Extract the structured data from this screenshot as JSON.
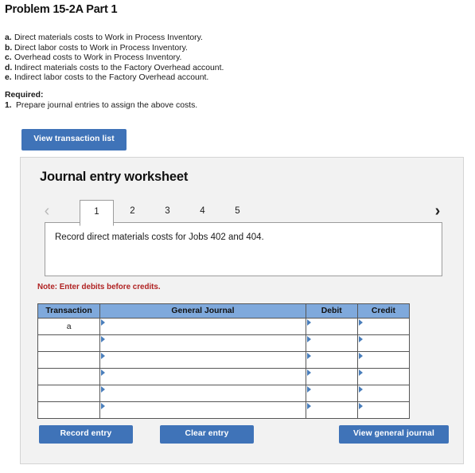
{
  "problem": {
    "title": "Problem 15-2A Part 1",
    "items": [
      {
        "letter": "a.",
        "text": "Direct materials costs to Work in Process Inventory."
      },
      {
        "letter": "b.",
        "text": "Direct labor costs to Work in Process Inventory."
      },
      {
        "letter": "c.",
        "text": "Overhead costs to Work in Process Inventory."
      },
      {
        "letter": "d.",
        "text": "Indirect materials costs to the Factory Overhead account."
      },
      {
        "letter": "e.",
        "text": "Indirect labor costs to the Factory Overhead account."
      }
    ],
    "required_label": "Required:",
    "required_items": [
      {
        "num": "1.",
        "text": "Prepare journal entries to assign the above costs."
      }
    ]
  },
  "toolbar": {
    "view_transaction_list_label": "View transaction list"
  },
  "worksheet": {
    "title": "Journal entry worksheet",
    "prev_arrow_icon": "chevron-left-icon",
    "next_arrow_icon": "chevron-right-icon",
    "tabs": [
      {
        "label": "1",
        "active": true
      },
      {
        "label": "2",
        "active": false
      },
      {
        "label": "3",
        "active": false
      },
      {
        "label": "4",
        "active": false
      },
      {
        "label": "5",
        "active": false
      }
    ],
    "instruction": "Record direct materials costs for Jobs 402 and 404.",
    "note": "Note: Enter debits before credits.",
    "note_color": "#b02222",
    "table": {
      "headers": [
        "Transaction",
        "General Journal",
        "Debit",
        "Credit"
      ],
      "header_bg": "#7fa9dc",
      "rows": [
        {
          "transaction": "a",
          "general_journal": "",
          "debit": "",
          "credit": ""
        },
        {
          "transaction": "",
          "general_journal": "",
          "debit": "",
          "credit": ""
        },
        {
          "transaction": "",
          "general_journal": "",
          "debit": "",
          "credit": ""
        },
        {
          "transaction": "",
          "general_journal": "",
          "debit": "",
          "credit": ""
        },
        {
          "transaction": "",
          "general_journal": "",
          "debit": "",
          "credit": ""
        },
        {
          "transaction": "",
          "general_journal": "",
          "debit": "",
          "credit": ""
        }
      ]
    },
    "footer": {
      "record_entry_label": "Record entry",
      "clear_entry_label": "Clear entry",
      "view_general_journal_label": "View general journal"
    }
  },
  "theme": {
    "button_blue": "#3f73b8",
    "panel_bg": "#f2f2f2",
    "table_border": "#565656",
    "marker_blue": "#4a7ebb"
  }
}
